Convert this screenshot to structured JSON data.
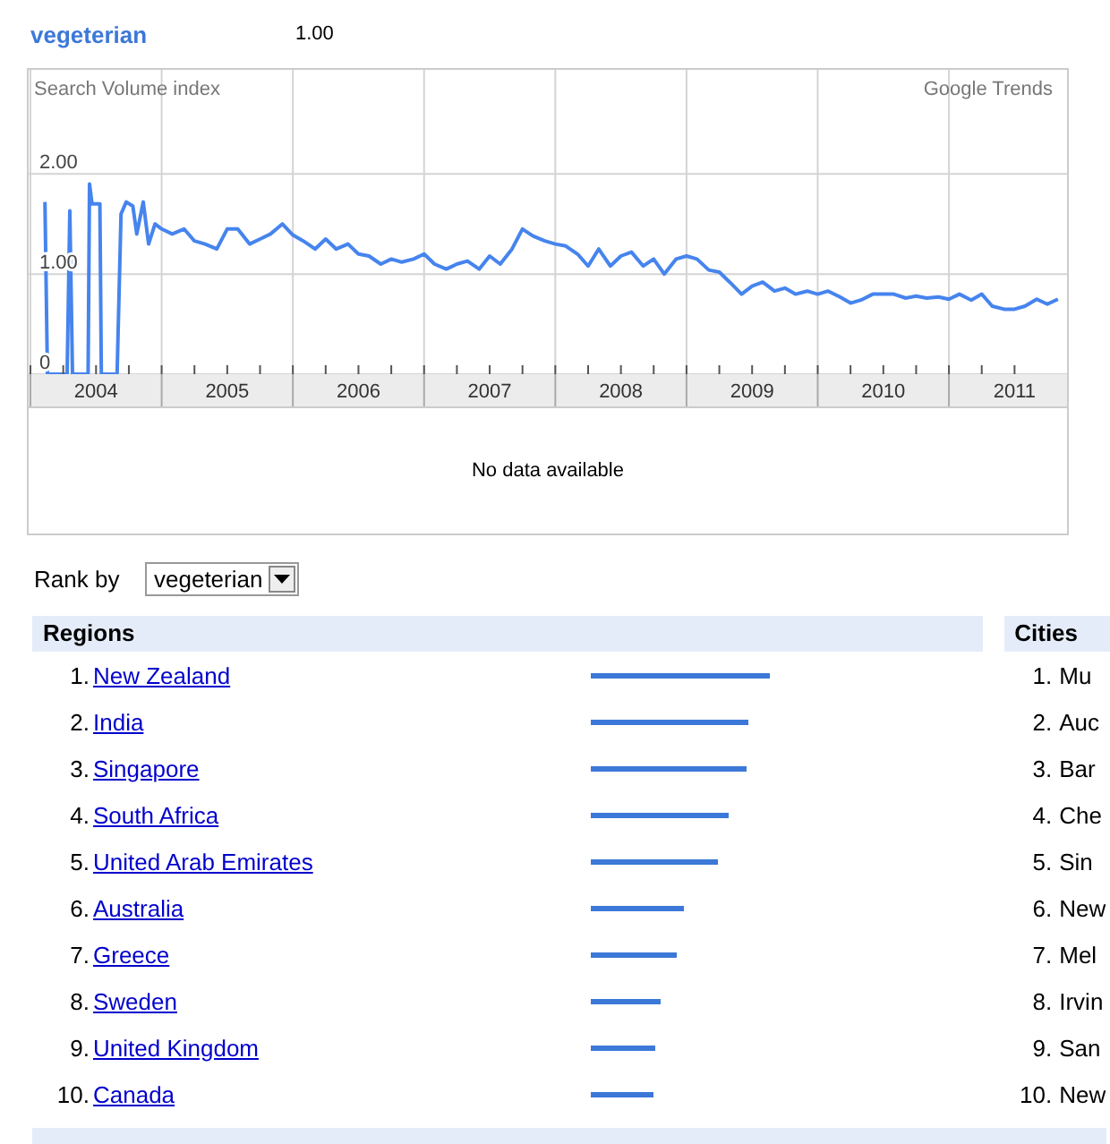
{
  "term": {
    "average": "1.00"
  },
  "trend": {
    "no_data_text": "No data available",
    "chart_data": {
      "type": "line",
      "title": "Google Trends",
      "ylabel": "Search Volume index",
      "grid": true,
      "xlim": [
        2004,
        2011.9
      ],
      "ylim": [
        0,
        3.04
      ],
      "x": [
        2004.11,
        2004.13,
        2004.28,
        2004.3,
        2004.32,
        2004.44,
        2004.45,
        2004.47,
        2004.53,
        2004.54,
        2004.66,
        2004.69,
        2004.73,
        2004.78,
        2004.81,
        2004.86,
        2004.9,
        2004.95,
        2005,
        2005.08,
        2005.17,
        2005.25,
        2005.33,
        2005.42,
        2005.5,
        2005.58,
        2005.67,
        2005.75,
        2005.83,
        2005.92,
        2006,
        2006.08,
        2006.17,
        2006.25,
        2006.33,
        2006.42,
        2006.5,
        2006.58,
        2006.67,
        2006.75,
        2006.83,
        2006.92,
        2007,
        2007.08,
        2007.17,
        2007.25,
        2007.33,
        2007.42,
        2007.5,
        2007.58,
        2007.67,
        2007.75,
        2007.83,
        2007.92,
        2008,
        2008.08,
        2008.17,
        2008.25,
        2008.33,
        2008.42,
        2008.5,
        2008.58,
        2008.67,
        2008.75,
        2008.83,
        2008.92,
        2009,
        2009.08,
        2009.17,
        2009.25,
        2009.33,
        2009.42,
        2009.5,
        2009.58,
        2009.67,
        2009.75,
        2009.83,
        2009.92,
        2010,
        2010.08,
        2010.17,
        2010.25,
        2010.33,
        2010.42,
        2010.5,
        2010.58,
        2010.67,
        2010.75,
        2010.83,
        2010.92,
        2011,
        2011.08,
        2011.17,
        2011.25,
        2011.33,
        2011.42,
        2011.5,
        2011.58,
        2011.67,
        2011.75,
        2011.83
      ],
      "yticks": [
        0,
        {
          "value": 1,
          "label": "1.00"
        },
        {
          "value": 2,
          "label": "2.00"
        }
      ],
      "xticks": [
        {
          "value": 2004.5,
          "label": "2004"
        },
        {
          "value": 2005.5,
          "label": "2005"
        },
        {
          "value": 2006.5,
          "label": "2006"
        },
        {
          "value": 2007.5,
          "label": "2007"
        },
        {
          "value": 2008.5,
          "label": "2008"
        },
        {
          "value": 2009.5,
          "label": "2009"
        },
        {
          "value": 2010.5,
          "label": "2010"
        },
        {
          "value": 2011.5,
          "label": "2011"
        }
      ],
      "series": [
        {
          "name": "vegeterian",
          "color": "#4684ee",
          "values": [
            1.72,
            0,
            0,
            1.63,
            0,
            0,
            1.9,
            1.7,
            1.7,
            0,
            0,
            1.6,
            1.72,
            1.68,
            1.4,
            1.72,
            1.3,
            1.5,
            1.45,
            1.4,
            1.45,
            1.33,
            1.3,
            1.25,
            1.45,
            1.45,
            1.3,
            1.35,
            1.4,
            1.5,
            1.39,
            1.33,
            1.25,
            1.35,
            1.25,
            1.3,
            1.2,
            1.18,
            1.1,
            1.15,
            1.12,
            1.15,
            1.2,
            1.1,
            1.05,
            1.1,
            1.13,
            1.05,
            1.18,
            1.1,
            1.25,
            1.45,
            1.38,
            1.33,
            1.3,
            1.28,
            1.2,
            1.08,
            1.25,
            1.08,
            1.18,
            1.22,
            1.08,
            1.15,
            1.0,
            1.15,
            1.18,
            1.15,
            1.04,
            1.02,
            0.92,
            0.8,
            0.88,
            0.92,
            0.83,
            0.86,
            0.8,
            0.83,
            0.8,
            0.83,
            0.77,
            0.71,
            0.74,
            0.8,
            0.8,
            0.8,
            0.76,
            0.78,
            0.76,
            0.77,
            0.75,
            0.8,
            0.74,
            0.8,
            0.68,
            0.65,
            0.65,
            0.68,
            0.75,
            0.7,
            0.75
          ]
        }
      ]
    }
  },
  "rank_by": {
    "label": "Rank by",
    "value": "vegeterian"
  },
  "regions": {
    "title": "Regions",
    "rows": [
      {
        "rank": "1.",
        "name": "New Zealand",
        "level": 1.0
      },
      {
        "rank": "2.",
        "name": "India",
        "level": 0.88
      },
      {
        "rank": "3.",
        "name": "Singapore",
        "level": 0.87
      },
      {
        "rank": "4.",
        "name": "South Africa",
        "level": 0.77
      },
      {
        "rank": "5.",
        "name": "United Arab Emirates",
        "level": 0.71
      },
      {
        "rank": "6.",
        "name": "Australia",
        "level": 0.52
      },
      {
        "rank": "7.",
        "name": "Greece",
        "level": 0.48
      },
      {
        "rank": "8.",
        "name": "Sweden",
        "level": 0.39
      },
      {
        "rank": "9.",
        "name": "United Kingdom",
        "level": 0.36
      },
      {
        "rank": "10.",
        "name": "Canada",
        "level": 0.35
      }
    ]
  },
  "cities": {
    "title": "Cities",
    "rows": [
      {
        "rank": "1.",
        "name": "Mu"
      },
      {
        "rank": "2.",
        "name": "Auc"
      },
      {
        "rank": "3.",
        "name": "Bar"
      },
      {
        "rank": "4.",
        "name": "Che"
      },
      {
        "rank": "5.",
        "name": "Sin"
      },
      {
        "rank": "6.",
        "name": "New"
      },
      {
        "rank": "7.",
        "name": "Mel"
      },
      {
        "rank": "8.",
        "name": "Irvin"
      },
      {
        "rank": "9.",
        "name": "San"
      },
      {
        "rank": "10.",
        "name": "New"
      }
    ]
  }
}
